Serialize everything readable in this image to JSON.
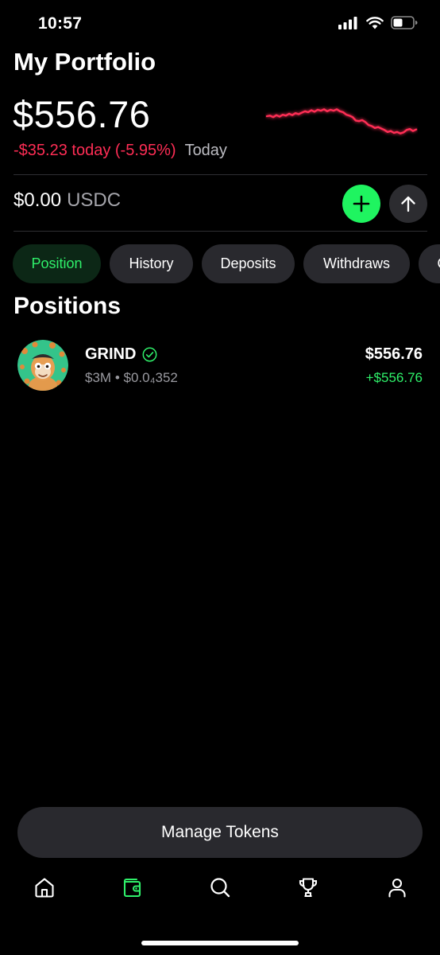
{
  "status_bar": {
    "time": "10:57"
  },
  "header": {
    "title": "My Portfolio",
    "balance": "$556.76",
    "change": "-$35.23 today (-5.95%)",
    "period": "Today",
    "sparkline": [
      0.42,
      0.43,
      0.4,
      0.44,
      0.41,
      0.45,
      0.43,
      0.47,
      0.44,
      0.48,
      0.46,
      0.49,
      0.52,
      0.5,
      0.54,
      0.51,
      0.55,
      0.53,
      0.56,
      0.52,
      0.55,
      0.53,
      0.56,
      0.52,
      0.5,
      0.45,
      0.43,
      0.4,
      0.33,
      0.32,
      0.34,
      0.3,
      0.24,
      0.22,
      0.18,
      0.2,
      0.17,
      0.14,
      0.1,
      0.12,
      0.08,
      0.1,
      0.07,
      0.09,
      0.14,
      0.16,
      0.12,
      0.15
    ],
    "sparkline_color": "#ff2d55"
  },
  "usdc": {
    "amount": "$0.00",
    "currency": "USDC"
  },
  "actions": {
    "add_icon": "plus-icon",
    "send_icon": "arrow-up-icon",
    "add_color": "#1ff460"
  },
  "tabs": [
    {
      "label": "Position",
      "active": true
    },
    {
      "label": "History",
      "active": false
    },
    {
      "label": "Deposits",
      "active": false
    },
    {
      "label": "Withdraws",
      "active": false
    },
    {
      "label": "C",
      "active": false
    }
  ],
  "positions": {
    "title": "Positions",
    "items": [
      {
        "symbol": "GRIND",
        "verified": true,
        "market_cap": "$3M",
        "separator": "•",
        "price": "$0.0₄352",
        "value": "$556.76",
        "change": "+$556.76"
      }
    ]
  },
  "manage_tokens": {
    "label": "Manage Tokens"
  },
  "bottom_nav": [
    {
      "icon": "home-icon",
      "active": false
    },
    {
      "icon": "wallet-icon",
      "active": true
    },
    {
      "icon": "search-icon",
      "active": false
    },
    {
      "icon": "trophy-icon",
      "active": false
    },
    {
      "icon": "profile-icon",
      "active": false
    }
  ],
  "colors": {
    "accent_green": "#2ff06a",
    "negative_red": "#ff2d55",
    "surface": "#29292e"
  }
}
